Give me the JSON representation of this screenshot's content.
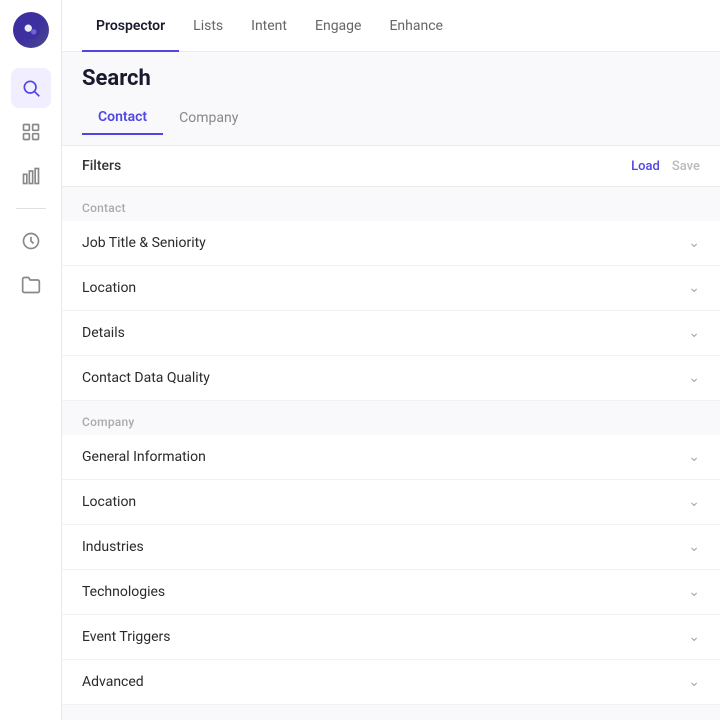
{
  "app": {
    "logo_alt": "Logo"
  },
  "top_nav": {
    "items": [
      {
        "label": "Prospector",
        "active": true
      },
      {
        "label": "Lists",
        "active": false
      },
      {
        "label": "Intent",
        "active": false
      },
      {
        "label": "Engage",
        "active": false
      },
      {
        "label": "Enhance",
        "active": false
      }
    ]
  },
  "search": {
    "title": "Search",
    "tabs": [
      {
        "label": "Contact",
        "active": true
      },
      {
        "label": "Company",
        "active": false
      }
    ],
    "filters_label": "Filters",
    "load_label": "Load",
    "save_label": "Save",
    "contact_section_label": "Contact",
    "company_section_label": "Company",
    "contact_filters": [
      {
        "label": "Job Title & Seniority"
      },
      {
        "label": "Location"
      },
      {
        "label": "Details"
      },
      {
        "label": "Contact Data Quality"
      }
    ],
    "company_filters": [
      {
        "label": "General Information"
      },
      {
        "label": "Location"
      },
      {
        "label": "Industries"
      },
      {
        "label": "Technologies"
      },
      {
        "label": "Event Triggers"
      },
      {
        "label": "Advanced"
      }
    ]
  },
  "sidebar": {
    "icons": [
      {
        "name": "search-icon",
        "active": true
      },
      {
        "name": "list-icon",
        "active": false
      },
      {
        "name": "bar-chart-icon",
        "active": false
      },
      {
        "name": "history-icon",
        "active": false
      },
      {
        "name": "folder-icon",
        "active": false
      }
    ]
  }
}
